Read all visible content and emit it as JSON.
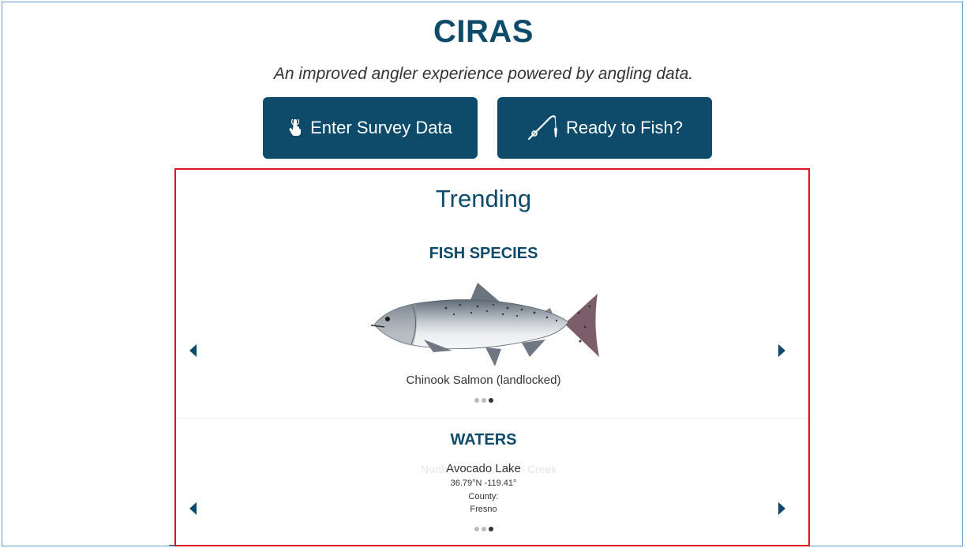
{
  "app": {
    "title": "CIRAS",
    "tagline": "An improved angler experience powered by angling data."
  },
  "actions": {
    "survey_label": "Enter Survey Data",
    "survey_icon": "hand-pointer-icon",
    "fish_label": "Ready to Fish?",
    "fish_icon": "fishing-rod-icon"
  },
  "trending": {
    "title": "Trending",
    "species": {
      "title": "FISH SPECIES",
      "current": "Chinook Salmon (landlocked)",
      "image": "chinook-salmon-image",
      "pager": {
        "count": 3,
        "active": 3
      }
    },
    "waters": {
      "title": "WATERS",
      "current_name": "Avocado Lake",
      "coords": "36.79°N -119.41°",
      "county_label": "County:",
      "county": "Fresno",
      "ghost_left": "North",
      "ghost_right": "Creek",
      "pager": {
        "count": 3,
        "active": 3
      }
    }
  },
  "colors": {
    "brand": "#0e4a6a",
    "highlight": "#e0141e"
  }
}
